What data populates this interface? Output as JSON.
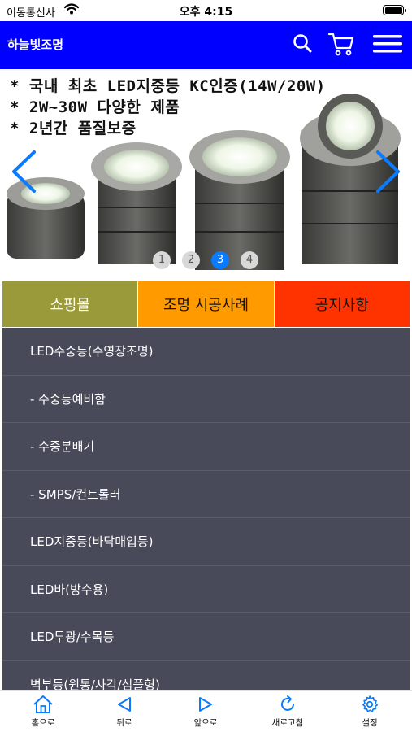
{
  "status_bar": {
    "carrier": "이동통신사",
    "time": "오후 4:15"
  },
  "header": {
    "title": "하늘빛조명"
  },
  "banner": {
    "lines": [
      "* 국내 최초 LED지중등 KC인증(14W/20W)",
      "* 2W~30W 다양한 제품",
      "* 2년간 품질보증"
    ],
    "dots": [
      "1",
      "2",
      "3",
      "4"
    ],
    "active_dot": "3"
  },
  "tabs": [
    {
      "label": "쇼핑몰",
      "bg": "#9a9a3a",
      "color": "#ffffff"
    },
    {
      "label": "조명 시공사례",
      "bg": "#ff9a00",
      "color": "#111111"
    },
    {
      "label": "공지사항",
      "bg": "#ff3300",
      "color": "#111111"
    }
  ],
  "menu": {
    "items": [
      "LED수중등(수영장조명)",
      "- 수중등예비함",
      "- 수중분배기",
      "- SMPS/컨트롤러",
      "LED지중등(바닥매입등)",
      "LED바(방수용)",
      "LED투광/수목등",
      "벽부등(원통/사각/심플형)"
    ]
  },
  "toolbar": {
    "home": "홈으로",
    "back": "뒤로",
    "forward": "앞으로",
    "refresh": "새로고침",
    "settings": "설정"
  },
  "colors": {
    "header_bg": "#0000ff",
    "menu_bg": "#484a5a",
    "accent": "#0a7bff"
  }
}
